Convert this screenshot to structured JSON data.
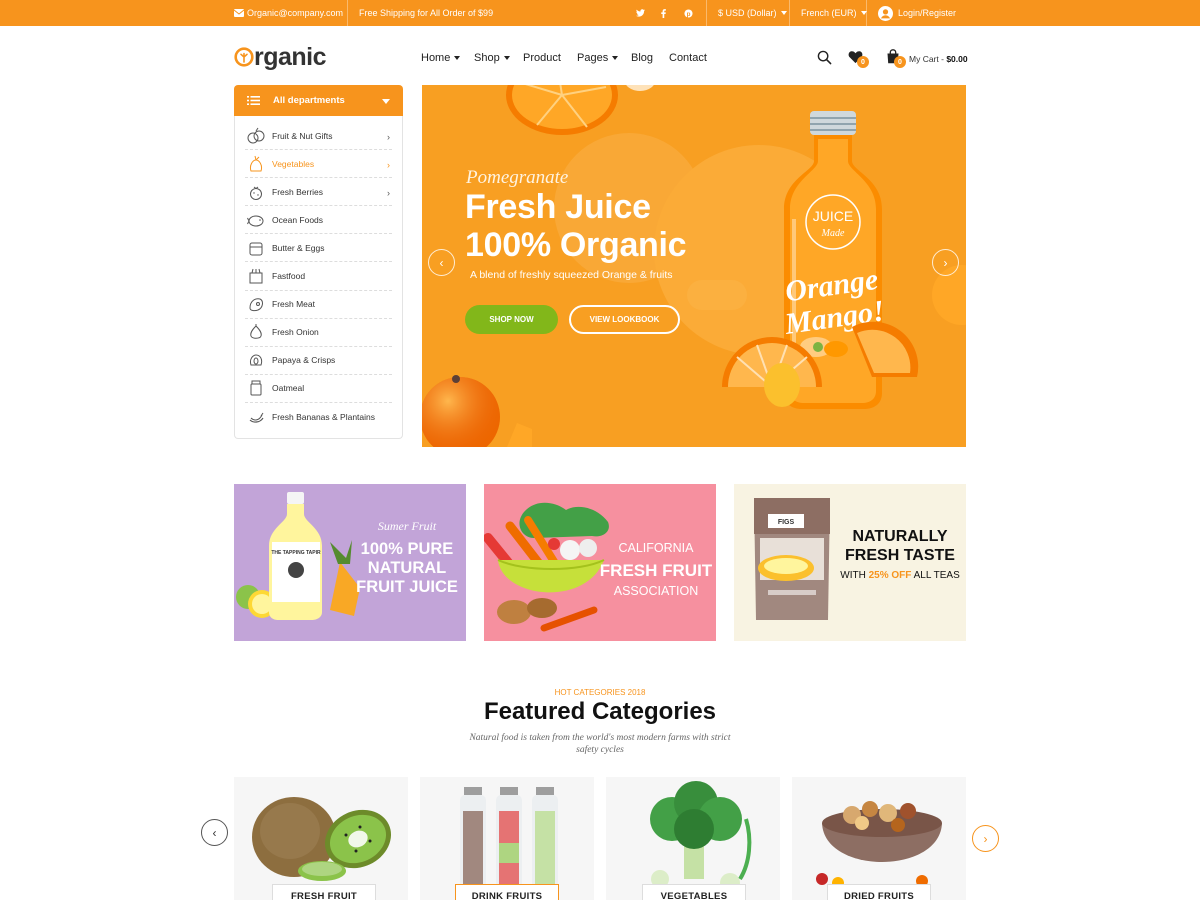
{
  "topbar": {
    "email": "Organic@company.com",
    "shipping": "Free Shipping for All Order of $99",
    "currency": "$ USD (Dollar)",
    "language": "French (EUR)",
    "login": "Login/Register",
    "social": [
      "twitter-icon",
      "facebook-icon",
      "pinterest-icon"
    ]
  },
  "brand": {
    "logo_initial": "O",
    "logo_rest": "rganic",
    "accent": "#f7941d",
    "green": "#82b71a"
  },
  "nav": {
    "items": [
      "Home",
      "Shop",
      "Product",
      "Pages",
      "Blog",
      "Contact"
    ]
  },
  "header": {
    "wishlist_count": "0",
    "cart_count": "0",
    "cart_label": "My Cart - ",
    "cart_total": "$0.00"
  },
  "sidebar": {
    "title": "All departments",
    "items": [
      "Fruit & Nut Gifts",
      "Vegetables",
      "Fresh Berries",
      "Ocean Foods",
      "Butter & Eggs",
      "Fastfood",
      "Fresh Meat",
      "Fresh Onion",
      "Papaya & Crisps",
      "Oatmeal",
      "Fresh Bananas & Plantains"
    ],
    "active_index": 1
  },
  "hero": {
    "subtitle": "Pomegranate",
    "title_line1": "Fresh Juice",
    "title_line2": "100% Organic",
    "description": "A blend of freshly squeezed Orange & fruits",
    "btn_shop": "SHOP NOW",
    "btn_look": "VIEW LOOKBOOK",
    "bottle_label_top": "JUICE",
    "bottle_label_mid": "Made",
    "bottle_script1": "Orange",
    "bottle_script2": "Mango!"
  },
  "banners": {
    "b1": {
      "subtitle": "Sumer Fruit",
      "line1": "100% PURE",
      "line2": "NATURAL",
      "line3": "FRUIT JUICE",
      "bottle_label": "THE TAPPING TAPIR"
    },
    "b2": {
      "line1": "CALIFORNIA",
      "line2": "FRESH FRUIT",
      "line3": "ASSOCIATION"
    },
    "b3": {
      "line1": "NATURALLY",
      "line2": "FRESH TASTE",
      "with": "WITH ",
      "discount": "25% OFF",
      "rest": " ALL TEAS",
      "pack_label": "FIGS"
    }
  },
  "featured": {
    "eyebrow": "HOT CATEGORIES 2018",
    "title": "Featured Categories",
    "description": "Natural food is taken from the world's most modern farms with strict safety cycles",
    "categories": [
      "FRESH FRUIT",
      "DRINK FRUITS",
      "VEGETABLES",
      "DRIED FRUITS"
    ]
  }
}
